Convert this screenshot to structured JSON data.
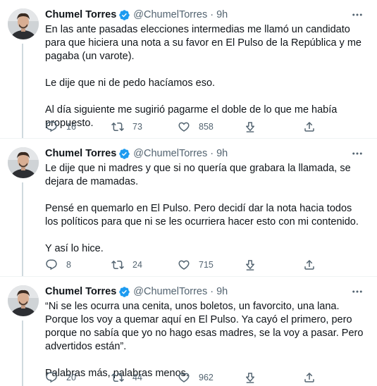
{
  "tweets": [
    {
      "name": "Chumel Torres",
      "handle": "@ChumelTorres",
      "separator": "·",
      "time": "9h",
      "paragraphs": [
        "En las ante pasadas elecciones intermedias me llamó un candidato para que hiciera una nota a su favor en El Pulso de la República y me pagaba (un varote).",
        "Le dije que ni de pedo hacíamos eso.",
        "Al día siguiente me sugirió pagarme el doble de lo que me había propuesto."
      ],
      "replies": "16",
      "retweets": "73",
      "likes": "858"
    },
    {
      "name": "Chumel Torres",
      "handle": "@ChumelTorres",
      "separator": "·",
      "time": "9h",
      "paragraphs": [
        "Le dije que ni madres y que si no quería que grabara la llamada, se dejara de mamadas.",
        "Pensé en quemarlo en El Pulso. Pero decidí dar la nota hacia todos los políticos para que ni se les ocurriera hacer esto con mi contenido.",
        "Y así lo hice."
      ],
      "replies": "8",
      "retweets": "24",
      "likes": "715"
    },
    {
      "name": "Chumel Torres",
      "handle": "@ChumelTorres",
      "separator": "·",
      "time": "9h",
      "paragraphs": [
        "“Ni se les ocurra una cenita, unos boletos, un favorcito, una lana. Porque los voy a quemar aquí en El Pulso. Ya cayó el primero, pero porque no sabía que yo no hago esas madres, se la voy a pasar. Pero advertidos están”.",
        "Palabras más, palabras menos."
      ],
      "replies": "20",
      "retweets": "44",
      "likes": "962"
    }
  ],
  "colors": {
    "text": "#0f1419",
    "secondary": "#536471",
    "verified": "#1d9bf0",
    "divider": "#eff3f4",
    "thread_line": "#cfd9de"
  },
  "icons": {
    "verified": "verified-badge-icon",
    "more": "more-options-icon",
    "reply": "reply-icon",
    "retweet": "retweet-icon",
    "like": "heart-icon",
    "dm": "download-icon",
    "share": "share-icon"
  }
}
